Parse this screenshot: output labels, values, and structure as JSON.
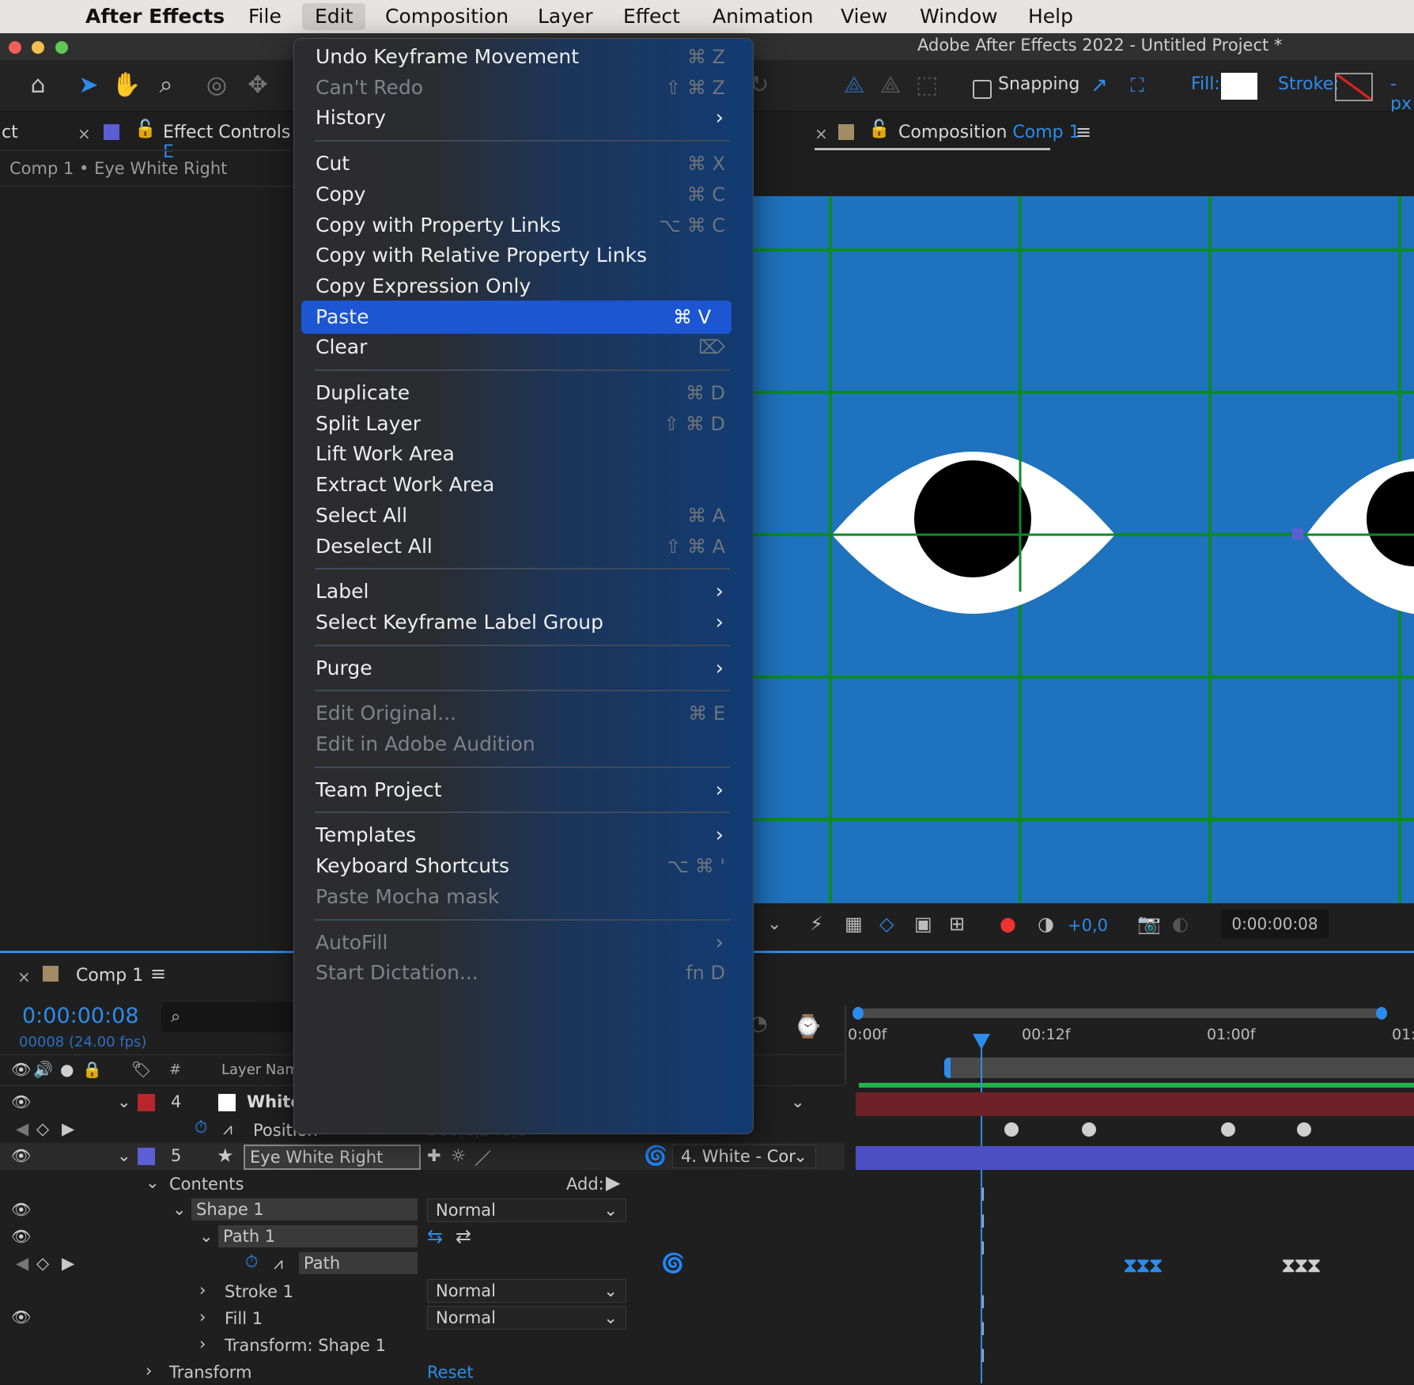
{
  "menubar": {
    "app_name": "After Effects",
    "items": [
      "File",
      "Edit",
      "Composition",
      "Layer",
      "Effect",
      "Animation",
      "View",
      "Window",
      "Help"
    ],
    "active": "Edit"
  },
  "window": {
    "title": "Adobe After Effects 2022 - Untitled Project *"
  },
  "toolbar": {
    "snapping_label": "Snapping",
    "fill_label": "Fill:",
    "stroke_label": "Stroke:",
    "px_label": "- px",
    "fill_color": "#ffffff",
    "accent": "#2d8ceb"
  },
  "left_panel": {
    "tab_cut": "ct",
    "tab_title": "Effect Controls",
    "tab_suffix": "E",
    "subtitle": "Comp 1 • Eye White Right"
  },
  "composition_panel": {
    "tab_prefix": "Composition",
    "tab_comp": "Comp 1",
    "viewer_bg": "#1f72bd",
    "grid_color": "#0c8a2a",
    "exposure": "+0,0",
    "timecode": "0:00:00:08"
  },
  "edit_menu": {
    "items": [
      {
        "label": "Undo Keyframe Movement",
        "shortcut": "⌘ Z",
        "disabled": false
      },
      {
        "label": "Can't Redo",
        "shortcut": "⇧ ⌘ Z",
        "disabled": true
      },
      {
        "label": "History",
        "submenu": true,
        "disabled": false
      },
      {
        "sep": true
      },
      {
        "label": "Cut",
        "shortcut": "⌘ X",
        "disabled": false
      },
      {
        "label": "Copy",
        "shortcut": "⌘ C",
        "disabled": false
      },
      {
        "label": "Copy with Property Links",
        "shortcut": "⌥ ⌘ C",
        "disabled": false
      },
      {
        "label": "Copy with Relative Property Links",
        "disabled": false
      },
      {
        "label": "Copy Expression Only",
        "disabled": false
      },
      {
        "label": "Paste",
        "shortcut": "⌘ V",
        "highlighted": true,
        "disabled": false
      },
      {
        "label": "Clear",
        "shortcut": "⌦",
        "disabled": false
      },
      {
        "sep": true
      },
      {
        "label": "Duplicate",
        "shortcut": "⌘ D",
        "disabled": false
      },
      {
        "label": "Split Layer",
        "shortcut": "⇧ ⌘ D",
        "disabled": false
      },
      {
        "label": "Lift Work Area",
        "disabled": false
      },
      {
        "label": "Extract Work Area",
        "disabled": false
      },
      {
        "label": "Select All",
        "shortcut": "⌘ A",
        "disabled": false
      },
      {
        "label": "Deselect All",
        "shortcut": "⇧ ⌘ A",
        "disabled": false
      },
      {
        "sep": true
      },
      {
        "label": "Label",
        "submenu": true,
        "disabled": false
      },
      {
        "label": "Select Keyframe Label Group",
        "submenu": true,
        "disabled": false
      },
      {
        "sep": true
      },
      {
        "label": "Purge",
        "submenu": true,
        "disabled": false
      },
      {
        "sep": true
      },
      {
        "label": "Edit Original...",
        "shortcut": "⌘ E",
        "disabled": true
      },
      {
        "label": "Edit in Adobe Audition",
        "disabled": true
      },
      {
        "sep": true
      },
      {
        "label": "Team Project",
        "submenu": true,
        "disabled": false
      },
      {
        "sep": true
      },
      {
        "label": "Templates",
        "submenu": true,
        "disabled": false
      },
      {
        "label": "Keyboard Shortcuts",
        "shortcut": "⌥ ⌘ '",
        "disabled": false
      },
      {
        "label": "Paste Mocha mask",
        "disabled": true
      },
      {
        "sep": true
      },
      {
        "label": "AutoFill",
        "submenu": true,
        "disabled": true
      },
      {
        "label": "Start Dictation...",
        "shortcut": "fn D",
        "disabled": true
      }
    ]
  },
  "timeline": {
    "tab": "Comp 1",
    "timecode": "0:00:00:08",
    "frames": "00008 (24.00 fps)",
    "col_number": "#",
    "col_layer_name": "Layer Nam",
    "ruler": [
      "0:00f",
      "00:12f",
      "01:00f",
      "01:"
    ],
    "layer4": {
      "num": "4",
      "name": "White",
      "color": "#b8252a",
      "bar_color": "#6d2227"
    },
    "position_label": "Position",
    "position_value": "960,0,540,0",
    "layer5": {
      "num": "5",
      "name": "Eye White Right",
      "color": "#5a5fd6",
      "bar_color": "#4c4fc4",
      "parent": "4. White - Cor"
    },
    "contents_label": "Contents",
    "add_label": "Add:",
    "shape1_label": "Shape 1",
    "path1_label": "Path 1",
    "path_label": "Path",
    "stroke1_label": "Stroke 1",
    "fill1_label": "Fill 1",
    "transform_shape_label": "Transform: Shape 1",
    "transform_label": "Transform",
    "reset_label": "Reset",
    "blend_mode": "Normal"
  }
}
